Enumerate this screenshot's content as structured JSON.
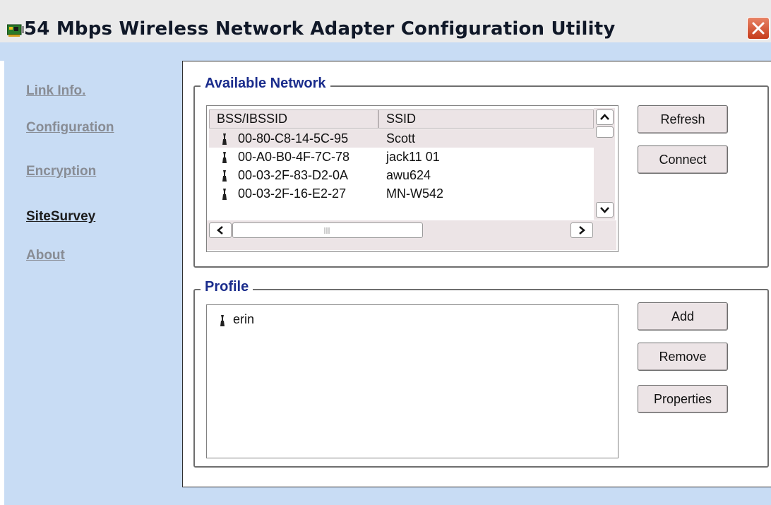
{
  "window": {
    "title": "54 Mbps Wireless Network Adapter Configuration Utility",
    "icon": "network-card-icon"
  },
  "sidebar": {
    "items": [
      {
        "label": "Link Info.",
        "active": false
      },
      {
        "label": "Configuration",
        "active": false
      },
      {
        "label": "Encryption",
        "active": false
      },
      {
        "label": "SiteSurvey",
        "active": true
      },
      {
        "label": "About",
        "active": false
      }
    ]
  },
  "available_network": {
    "legend": "Available Network",
    "columns": [
      "BSS/IBSSID",
      "SSID"
    ],
    "rows": [
      {
        "bssid": "00-80-C8-14-5C-95",
        "ssid": "Scott",
        "selected": true
      },
      {
        "bssid": "00-A0-B0-4F-7C-78",
        "ssid": "jack11 01",
        "selected": false
      },
      {
        "bssid": "00-03-2F-83-D2-0A",
        "ssid": "awu624",
        "selected": false
      },
      {
        "bssid": "00-03-2F-16-E2-27",
        "ssid": "MN-W542",
        "selected": false
      }
    ],
    "buttons": {
      "refresh": "Refresh",
      "connect": "Connect"
    },
    "row_icon": "wireless-antenna-icon"
  },
  "profile": {
    "legend": "Profile",
    "items": [
      "erin"
    ],
    "buttons": {
      "add": "Add",
      "remove": "Remove",
      "properties": "Properties"
    }
  },
  "colors": {
    "accent_blue": "#1a2c8c",
    "sidebar_bg": "#c8dcf4",
    "button_face": "#ece4e6",
    "close_red": "#d4532f"
  }
}
